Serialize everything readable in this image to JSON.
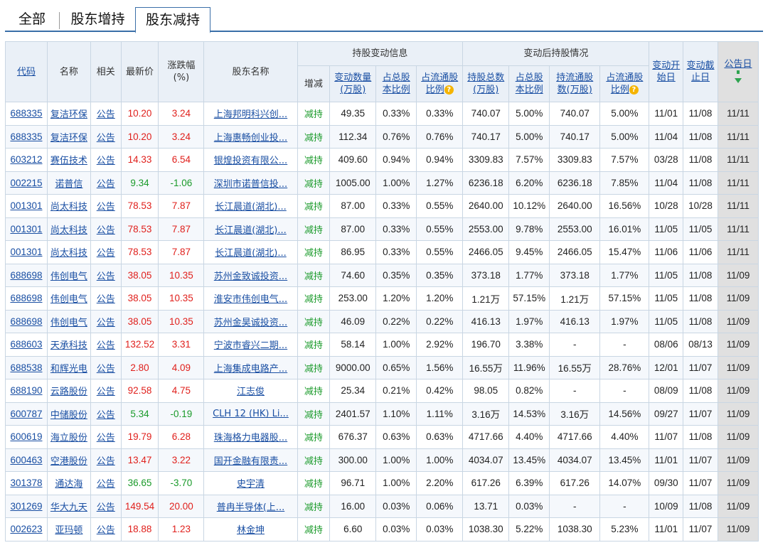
{
  "tabs": [
    {
      "label": "全部",
      "active": false
    },
    {
      "label": "股东增持",
      "active": false
    },
    {
      "label": "股东减持",
      "active": true
    }
  ],
  "headers": {
    "code": "代码",
    "name": "名称",
    "related": "相关",
    "price": "最新价",
    "change": "涨跌幅",
    "change_unit": "(%)",
    "holder": "股东名称",
    "group_change": "持股变动信息",
    "group_after": "变动后持股情况",
    "direction": "增减",
    "change_qty_1": "变动数量",
    "change_qty_2": "(万股)",
    "total_ratio_1": "占总股",
    "total_ratio_2": "本比例",
    "float_ratio_1": "占流通股",
    "float_ratio_2": "比例",
    "hold_total_1": "持股总数",
    "hold_total_2": "(万股)",
    "after_total_ratio_1": "占总股",
    "after_total_ratio_2": "本比例",
    "hold_float_1": "持流通股",
    "hold_float_2": "数(万股)",
    "after_float_ratio_1": "占流通股",
    "after_float_ratio_2": "比例",
    "start_1": "变动开",
    "start_2": "始日",
    "end_1": "变动截",
    "end_2": "止日",
    "announce": "公告日"
  },
  "rows": [
    {
      "code": "688335",
      "name": "复洁环保",
      "link": "公告",
      "price": "10.20",
      "chg": "3.24",
      "trend": "up",
      "holder": "上海邦明科兴创...",
      "dir": "减持",
      "qty": "49.35",
      "tr": "0.33%",
      "fr": "0.33%",
      "ht": "740.07",
      "atr": "5.00%",
      "hf": "740.07",
      "afr": "5.00%",
      "start": "11/01",
      "end": "11/08",
      "ann": "11/11"
    },
    {
      "code": "688335",
      "name": "复洁环保",
      "link": "公告",
      "price": "10.20",
      "chg": "3.24",
      "trend": "up",
      "holder": "上海惠畅创业投...",
      "dir": "减持",
      "qty": "112.34",
      "tr": "0.76%",
      "fr": "0.76%",
      "ht": "740.17",
      "atr": "5.00%",
      "hf": "740.17",
      "afr": "5.00%",
      "start": "11/04",
      "end": "11/08",
      "ann": "11/11"
    },
    {
      "code": "603212",
      "name": "赛伍技术",
      "link": "公告",
      "price": "14.33",
      "chg": "6.54",
      "trend": "up",
      "holder": "银煌投资有限公...",
      "dir": "减持",
      "qty": "409.60",
      "tr": "0.94%",
      "fr": "0.94%",
      "ht": "3309.83",
      "atr": "7.57%",
      "hf": "3309.83",
      "afr": "7.57%",
      "start": "03/28",
      "end": "11/08",
      "ann": "11/11"
    },
    {
      "code": "002215",
      "name": "诺普信",
      "link": "公告",
      "price": "9.34",
      "chg": "-1.06",
      "trend": "down",
      "holder": "深圳市诺普信投...",
      "dir": "减持",
      "qty": "1005.00",
      "tr": "1.00%",
      "fr": "1.27%",
      "ht": "6236.18",
      "atr": "6.20%",
      "hf": "6236.18",
      "afr": "7.85%",
      "start": "11/04",
      "end": "11/08",
      "ann": "11/11"
    },
    {
      "code": "001301",
      "name": "尚太科技",
      "link": "公告",
      "price": "78.53",
      "chg": "7.87",
      "trend": "up",
      "holder": "长江晨道(湖北)...",
      "dir": "减持",
      "qty": "87.00",
      "tr": "0.33%",
      "fr": "0.55%",
      "ht": "2640.00",
      "atr": "10.12%",
      "hf": "2640.00",
      "afr": "16.56%",
      "start": "10/28",
      "end": "10/28",
      "ann": "11/11"
    },
    {
      "code": "001301",
      "name": "尚太科技",
      "link": "公告",
      "price": "78.53",
      "chg": "7.87",
      "trend": "up",
      "holder": "长江晨道(湖北)...",
      "dir": "减持",
      "qty": "87.00",
      "tr": "0.33%",
      "fr": "0.55%",
      "ht": "2553.00",
      "atr": "9.78%",
      "hf": "2553.00",
      "afr": "16.01%",
      "start": "11/05",
      "end": "11/05",
      "ann": "11/11"
    },
    {
      "code": "001301",
      "name": "尚太科技",
      "link": "公告",
      "price": "78.53",
      "chg": "7.87",
      "trend": "up",
      "holder": "长江晨道(湖北)...",
      "dir": "减持",
      "qty": "86.95",
      "tr": "0.33%",
      "fr": "0.55%",
      "ht": "2466.05",
      "atr": "9.45%",
      "hf": "2466.05",
      "afr": "15.47%",
      "start": "11/06",
      "end": "11/06",
      "ann": "11/11"
    },
    {
      "code": "688698",
      "name": "伟创电气",
      "link": "公告",
      "price": "38.05",
      "chg": "10.35",
      "trend": "up",
      "holder": "苏州金致诚投资...",
      "dir": "减持",
      "qty": "74.60",
      "tr": "0.35%",
      "fr": "0.35%",
      "ht": "373.18",
      "atr": "1.77%",
      "hf": "373.18",
      "afr": "1.77%",
      "start": "11/05",
      "end": "11/08",
      "ann": "11/09"
    },
    {
      "code": "688698",
      "name": "伟创电气",
      "link": "公告",
      "price": "38.05",
      "chg": "10.35",
      "trend": "up",
      "holder": "淮安市伟创电气...",
      "dir": "减持",
      "qty": "253.00",
      "tr": "1.20%",
      "fr": "1.20%",
      "ht": "1.21万",
      "atr": "57.15%",
      "hf": "1.21万",
      "afr": "57.15%",
      "start": "11/05",
      "end": "11/08",
      "ann": "11/09"
    },
    {
      "code": "688698",
      "name": "伟创电气",
      "link": "公告",
      "price": "38.05",
      "chg": "10.35",
      "trend": "up",
      "holder": "苏州金昊诚投资...",
      "dir": "减持",
      "qty": "46.09",
      "tr": "0.22%",
      "fr": "0.22%",
      "ht": "416.13",
      "atr": "1.97%",
      "hf": "416.13",
      "afr": "1.97%",
      "start": "11/05",
      "end": "11/08",
      "ann": "11/09"
    },
    {
      "code": "688603",
      "name": "天承科技",
      "link": "公告",
      "price": "132.52",
      "chg": "3.31",
      "trend": "up",
      "holder": "宁波市睿兴二期...",
      "dir": "减持",
      "qty": "58.14",
      "tr": "1.00%",
      "fr": "2.92%",
      "ht": "196.70",
      "atr": "3.38%",
      "hf": "-",
      "afr": "-",
      "start": "08/06",
      "end": "08/13",
      "ann": "11/09"
    },
    {
      "code": "688538",
      "name": "和辉光电",
      "link": "公告",
      "price": "2.80",
      "chg": "4.09",
      "trend": "up",
      "holder": "上海集成电路产...",
      "dir": "减持",
      "qty": "9000.00",
      "tr": "0.65%",
      "fr": "1.56%",
      "ht": "16.55万",
      "atr": "11.96%",
      "hf": "16.55万",
      "afr": "28.76%",
      "start": "12/01",
      "end": "11/07",
      "ann": "11/09"
    },
    {
      "code": "688190",
      "name": "云路股份",
      "link": "公告",
      "price": "92.58",
      "chg": "4.75",
      "trend": "up",
      "holder": "江志俊",
      "dir": "减持",
      "qty": "25.34",
      "tr": "0.21%",
      "fr": "0.42%",
      "ht": "98.05",
      "atr": "0.82%",
      "hf": "-",
      "afr": "-",
      "start": "08/09",
      "end": "11/08",
      "ann": "11/09"
    },
    {
      "code": "600787",
      "name": "中储股份",
      "link": "公告",
      "price": "5.34",
      "chg": "-0.19",
      "trend": "down",
      "holder": "CLH 12 (HK) Li...",
      "dir": "减持",
      "qty": "2401.57",
      "tr": "1.10%",
      "fr": "1.11%",
      "ht": "3.16万",
      "atr": "14.53%",
      "hf": "3.16万",
      "afr": "14.56%",
      "start": "09/27",
      "end": "11/07",
      "ann": "11/09"
    },
    {
      "code": "600619",
      "name": "海立股份",
      "link": "公告",
      "price": "19.79",
      "chg": "6.28",
      "trend": "up",
      "holder": "珠海格力电器股...",
      "dir": "减持",
      "qty": "676.37",
      "tr": "0.63%",
      "fr": "0.63%",
      "ht": "4717.66",
      "atr": "4.40%",
      "hf": "4717.66",
      "afr": "4.40%",
      "start": "11/07",
      "end": "11/08",
      "ann": "11/09"
    },
    {
      "code": "600463",
      "name": "空港股份",
      "link": "公告",
      "price": "13.47",
      "chg": "3.22",
      "trend": "up",
      "holder": "国开金融有限责...",
      "dir": "减持",
      "qty": "300.00",
      "tr": "1.00%",
      "fr": "1.00%",
      "ht": "4034.07",
      "atr": "13.45%",
      "hf": "4034.07",
      "afr": "13.45%",
      "start": "11/01",
      "end": "11/07",
      "ann": "11/09"
    },
    {
      "code": "301378",
      "name": "通达海",
      "link": "公告",
      "price": "36.65",
      "chg": "-3.70",
      "trend": "down",
      "holder": "史宇清",
      "dir": "减持",
      "qty": "96.71",
      "tr": "1.00%",
      "fr": "2.20%",
      "ht": "617.26",
      "atr": "6.39%",
      "hf": "617.26",
      "afr": "14.07%",
      "start": "09/30",
      "end": "11/07",
      "ann": "11/09"
    },
    {
      "code": "301269",
      "name": "华大九天",
      "link": "公告",
      "price": "149.54",
      "chg": "20.00",
      "trend": "up",
      "holder": "普冉半导体(上...",
      "dir": "减持",
      "qty": "16.00",
      "tr": "0.03%",
      "fr": "0.06%",
      "ht": "13.71",
      "atr": "0.03%",
      "hf": "-",
      "afr": "-",
      "start": "10/09",
      "end": "11/08",
      "ann": "11/09"
    },
    {
      "code": "002623",
      "name": "亚玛顿",
      "link": "公告",
      "price": "18.88",
      "chg": "1.23",
      "trend": "up",
      "holder": "林金坤",
      "dir": "减持",
      "qty": "6.60",
      "tr": "0.03%",
      "fr": "0.03%",
      "ht": "1038.30",
      "atr": "5.22%",
      "hf": "1038.30",
      "afr": "5.23%",
      "start": "11/01",
      "end": "11/07",
      "ann": "11/09"
    }
  ],
  "colors": {
    "up": "#e0201c",
    "down": "#1a9a2a",
    "link": "#1a4fa3",
    "header_bg": "#eaf0f7",
    "border": "#c9d6e3"
  }
}
